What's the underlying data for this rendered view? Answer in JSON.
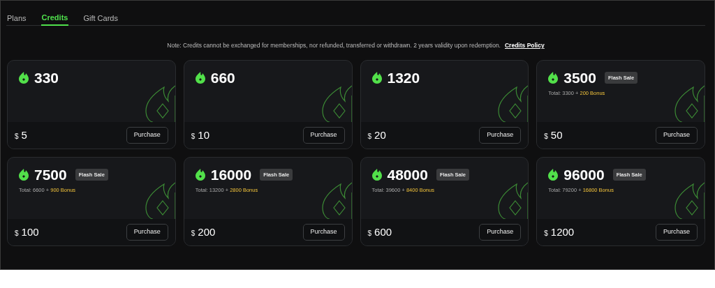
{
  "tabs": [
    {
      "label": "Plans",
      "selected": false
    },
    {
      "label": "Credits",
      "selected": true
    },
    {
      "label": "Gift Cards",
      "selected": false
    }
  ],
  "note": {
    "text": "Note: Credits cannot be exchanged for memberships, nor refunded, transferred or withdrawn. 2 years validity upon redemption.",
    "link": "Credits Policy"
  },
  "packages": [
    {
      "credits": "330",
      "currency": "$",
      "price": "5",
      "button": "Purchase"
    },
    {
      "credits": "660",
      "currency": "$",
      "price": "10",
      "button": "Purchase"
    },
    {
      "credits": "1320",
      "currency": "$",
      "price": "20",
      "button": "Purchase"
    },
    {
      "credits": "3500",
      "badge": "Flash Sale",
      "total": "Total: 3300 +",
      "bonus": "200 Bonus",
      "currency": "$",
      "price": "50",
      "button": "Purchase"
    },
    {
      "credits": "7500",
      "badge": "Flash Sale",
      "total": "Total: 6600 +",
      "bonus": "900 Bonus",
      "currency": "$",
      "price": "100",
      "button": "Purchase"
    },
    {
      "credits": "16000",
      "badge": "Flash Sale",
      "total": "Total: 13200 +",
      "bonus": "2800 Bonus",
      "currency": "$",
      "price": "200",
      "button": "Purchase"
    },
    {
      "credits": "48000",
      "badge": "Flash Sale",
      "total": "Total: 39600 +",
      "bonus": "8400 Bonus",
      "currency": "$",
      "price": "600",
      "button": "Purchase"
    },
    {
      "credits": "96000",
      "badge": "Flash Sale",
      "total": "Total: 79200 +",
      "bonus": "16800 Bonus",
      "currency": "$",
      "price": "1200",
      "button": "Purchase"
    }
  ]
}
